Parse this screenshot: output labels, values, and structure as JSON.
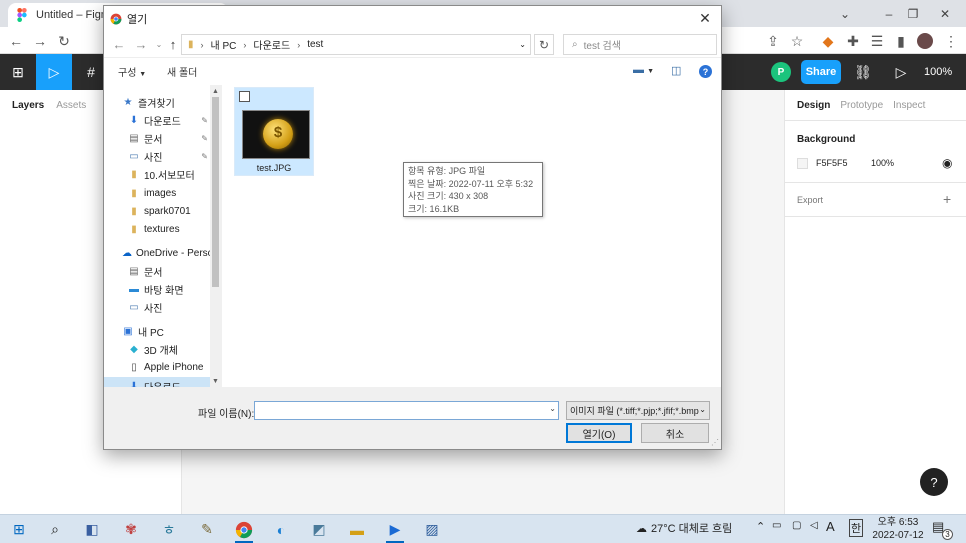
{
  "browser": {
    "tab_title": "Untitled – Figma",
    "window_controls": [
      "⌄",
      "–",
      "❐",
      "✕"
    ]
  },
  "figma": {
    "share_label": "Share",
    "avatar_initial": "P",
    "zoom": "100%",
    "left_tabs": [
      "Layers",
      "Assets"
    ],
    "right_tabs": [
      "Design",
      "Prototype",
      "Inspect"
    ],
    "background_label": "Background",
    "bg_hex": "F5F5F5",
    "bg_opacity": "100%",
    "export_label": "Export",
    "help": "?"
  },
  "dialog": {
    "title": "열기",
    "breadcrumb": [
      "내 PC",
      "다운로드",
      "test"
    ],
    "search_placeholder": "test 검색",
    "organize": "구성",
    "new_folder": "새 폴더",
    "nav_items": [
      {
        "label": "즐겨찾기",
        "icon": "star-icon",
        "glyph": "★"
      },
      {
        "label": "다운로드",
        "icon": "download-icon",
        "glyph": "⬇",
        "pinned": true
      },
      {
        "label": "문서",
        "icon": "document-icon",
        "glyph": "▤",
        "pinned": true
      },
      {
        "label": "사진",
        "icon": "picture-icon",
        "glyph": "▭",
        "pinned": true
      },
      {
        "label": "10.서보모터",
        "icon": "folder-icon",
        "glyph": "▮"
      },
      {
        "label": "images",
        "icon": "folder-icon",
        "glyph": "▮"
      },
      {
        "label": "spark0701",
        "icon": "folder-icon",
        "glyph": "▮"
      },
      {
        "label": "textures",
        "icon": "folder-icon",
        "glyph": "▮"
      },
      {
        "label": "OneDrive - Person",
        "icon": "cloud-icon",
        "glyph": "☁"
      },
      {
        "label": "문서",
        "icon": "document-icon",
        "glyph": "▤"
      },
      {
        "label": "바탕 화면",
        "icon": "desktop-icon",
        "glyph": "▬"
      },
      {
        "label": "사진",
        "icon": "picture-icon",
        "glyph": "▭"
      },
      {
        "label": "내 PC",
        "icon": "computer-icon",
        "glyph": "▣"
      },
      {
        "label": "3D 개체",
        "icon": "cube-icon",
        "glyph": "◆"
      },
      {
        "label": "Apple iPhone",
        "icon": "phone-icon",
        "glyph": "▯"
      },
      {
        "label": "다운로드",
        "icon": "download-icon",
        "glyph": "⬇"
      }
    ],
    "file": {
      "name": "test.JPG"
    },
    "tooltip": {
      "type": "항목 유형: JPG 파일",
      "date": "찍은 날짜: 2022-07-11 오후 5:32",
      "dimensions": "사진 크기: 430 x 308",
      "size": "크기: 16.1KB"
    },
    "filename_label": "파일 이름(N):",
    "filename_value": "",
    "filetype": "이미지 파일 (*.tiff;*.pjp;*.jfif;*.bmp",
    "open_button": "열기(O)",
    "cancel_button": "취소"
  },
  "taskbar": {
    "weather": "27°C  대체로 흐림",
    "ime": "A",
    "ime_mode": "한",
    "time": "오후 6:53",
    "date": "2022-07-12",
    "notification_count": "3"
  }
}
